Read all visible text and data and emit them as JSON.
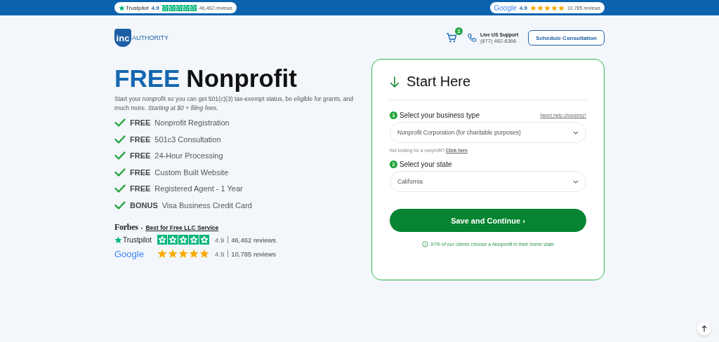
{
  "top_bar": {
    "ratings": [
      {
        "kind": "trustpilot",
        "brand": "Trustpilot",
        "score": "4.9",
        "stars": 5,
        "reviews": "46,462 reviews"
      },
      {
        "kind": "google",
        "brand": "Google",
        "score": "4.9",
        "stars": 5,
        "reviews": "10,785 reviews"
      }
    ]
  },
  "header": {
    "logo": {
      "mark": "inc",
      "name": "AUTHORITY"
    },
    "cart_count": "1",
    "support": {
      "label": "Live US Support",
      "phone": "(877) 462-6366"
    },
    "button": "Schedule Consultation"
  },
  "hero": {
    "title_highlight": "FREE",
    "title_rest": "Nonprofit",
    "description": "Start your nonprofit so you can get 501(c)(3) tax-exempt status, be eligible for grants, and much more. *Starting at $0 + filing fees.*",
    "features": [
      {
        "tag": "FREE",
        "text": "Nonprofit Registration"
      },
      {
        "tag": "FREE",
        "text": "501c3 Consultation"
      },
      {
        "tag": "FREE",
        "text": "24-Hour Processing"
      },
      {
        "tag": "FREE",
        "text": "Custom Built Website"
      },
      {
        "tag": "FREE",
        "text": "Registered Agent - 1 Year"
      },
      {
        "tag": "BONUS",
        "text": "Visa Business Credit Card"
      }
    ],
    "press": {
      "brand": "Forbes",
      "separator": "-",
      "link": "Best for Free LLC Service"
    },
    "ratings": [
      {
        "kind": "trustpilot",
        "brand": "Trustpilot",
        "stars": 5,
        "score": "4.9",
        "reviews": "46,462 reviews"
      },
      {
        "kind": "google",
        "brand": "Google",
        "stars": 5,
        "score": "4.9",
        "reviews": "10,785 reviews"
      }
    ]
  },
  "form": {
    "title": "Start Here",
    "steps": [
      {
        "number": "1",
        "label": "Select your business type",
        "help_link": "Need help choosing?",
        "value": "Nonprofit Corporation (for charitable purposes)",
        "note": {
          "text": "Not looking for a nonprofit?",
          "link": "Click here",
          "end": "."
        }
      },
      {
        "number": "2",
        "label": "Select your state",
        "value": "California"
      }
    ],
    "submit": "Save and Continue ›",
    "footnote": "97% of our clients choose a Nonprofit in their home state"
  }
}
